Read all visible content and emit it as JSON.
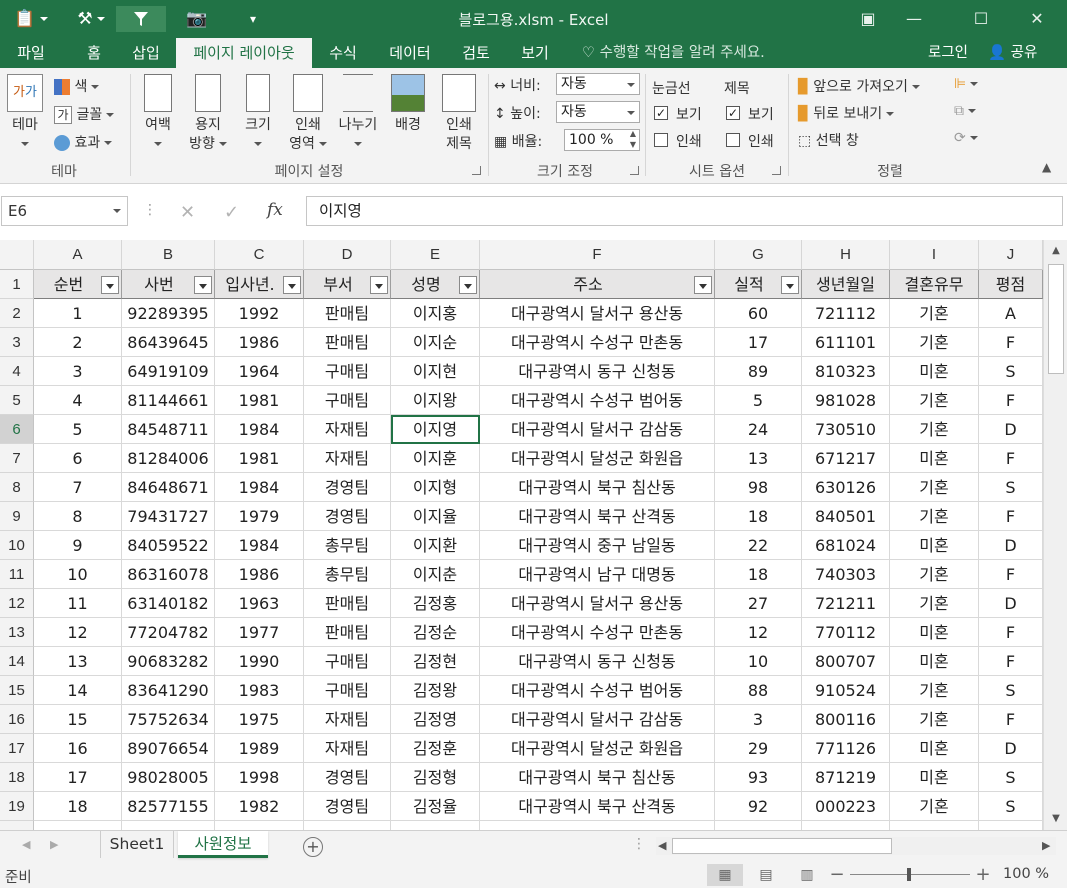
{
  "window": {
    "title": "블로그용.xlsm - Excel"
  },
  "ribbon_tabs": [
    "파일",
    "홈",
    "삽입",
    "페이지 레이아웃",
    "수식",
    "데이터",
    "검토",
    "보기"
  ],
  "tell_me": "수행할 작업을 알려 주세요.",
  "account": {
    "login": "로그인",
    "share": "공유"
  },
  "ribbon": {
    "theme": {
      "themes": "테마",
      "colors": "색",
      "fonts": "글꼴",
      "effects": "효과",
      "group": "테마"
    },
    "page_setup": {
      "margins": "여백",
      "orientation_1": "용지",
      "orientation_2": "방향",
      "size": "크기",
      "print_area_1": "인쇄",
      "print_area_2": "영역",
      "breaks": "나누기",
      "background": "배경",
      "print_titles_1": "인쇄",
      "print_titles_2": "제목",
      "group": "페이지 설정"
    },
    "scale": {
      "width_label": "너비:",
      "width_value": "자동",
      "height_label": "높이:",
      "height_value": "자동",
      "scale_label": "배율:",
      "scale_value": "100 %",
      "group": "크기 조정"
    },
    "sheet_options": {
      "gridlines": "눈금선",
      "headings": "제목",
      "view": "보기",
      "print": "인쇄",
      "group": "시트 옵션"
    },
    "arrange": {
      "bring_forward": "앞으로 가져오기",
      "send_backward": "뒤로 보내기",
      "selection_pane": "선택 창",
      "group": "정렬"
    }
  },
  "formula_bar": {
    "name_box": "E6",
    "formula": "이지영",
    "fx": "fx"
  },
  "columns": [
    "A",
    "B",
    "C",
    "D",
    "E",
    "F",
    "G",
    "H",
    "I",
    "J"
  ],
  "header_row": [
    "순번",
    "사번",
    "입사년.",
    "부서",
    "성명",
    "주소",
    "실적",
    "생년월일",
    "결혼유무",
    "평점"
  ],
  "rows": [
    [
      "1",
      "92289395",
      "1992",
      "판매팀",
      "이지홍",
      "대구광역시 달서구 용산동",
      "60",
      "721112",
      "기혼",
      "A"
    ],
    [
      "2",
      "86439645",
      "1986",
      "판매팀",
      "이지순",
      "대구광역시 수성구 만촌동",
      "17",
      "611101",
      "기혼",
      "F"
    ],
    [
      "3",
      "64919109",
      "1964",
      "구매팀",
      "이지현",
      "대구광역시 동구 신청동",
      "89",
      "810323",
      "미혼",
      "S"
    ],
    [
      "4",
      "81144661",
      "1981",
      "구매팀",
      "이지왕",
      "대구광역시 수성구 범어동",
      "5",
      "981028",
      "기혼",
      "F"
    ],
    [
      "5",
      "84548711",
      "1984",
      "자재팀",
      "이지영",
      "대구광역시 달서구 감삼동",
      "24",
      "730510",
      "기혼",
      "D"
    ],
    [
      "6",
      "81284006",
      "1981",
      "자재팀",
      "이지훈",
      "대구광역시 달성군 화원읍",
      "13",
      "671217",
      "미혼",
      "F"
    ],
    [
      "7",
      "84648671",
      "1984",
      "경영팀",
      "이지형",
      "대구광역시 북구 침산동",
      "98",
      "630126",
      "기혼",
      "S"
    ],
    [
      "8",
      "79431727",
      "1979",
      "경영팀",
      "이지율",
      "대구광역시 북구 산격동",
      "18",
      "840501",
      "기혼",
      "F"
    ],
    [
      "9",
      "84059522",
      "1984",
      "총무팀",
      "이지환",
      "대구광역시 중구 남일동",
      "22",
      "681024",
      "미혼",
      "D"
    ],
    [
      "10",
      "86316078",
      "1986",
      "총무팀",
      "이지춘",
      "대구광역시 남구 대명동",
      "18",
      "740303",
      "기혼",
      "F"
    ],
    [
      "11",
      "63140182",
      "1963",
      "판매팀",
      "김정홍",
      "대구광역시 달서구 용산동",
      "27",
      "721211",
      "기혼",
      "D"
    ],
    [
      "12",
      "77204782",
      "1977",
      "판매팀",
      "김정순",
      "대구광역시 수성구 만촌동",
      "12",
      "770112",
      "미혼",
      "F"
    ],
    [
      "13",
      "90683282",
      "1990",
      "구매팀",
      "김정현",
      "대구광역시 동구 신청동",
      "10",
      "800707",
      "미혼",
      "F"
    ],
    [
      "14",
      "83641290",
      "1983",
      "구매팀",
      "김정왕",
      "대구광역시 수성구 범어동",
      "88",
      "910524",
      "기혼",
      "S"
    ],
    [
      "15",
      "75752634",
      "1975",
      "자재팀",
      "김정영",
      "대구광역시 달서구 감삼동",
      "3",
      "800116",
      "기혼",
      "F"
    ],
    [
      "16",
      "89076654",
      "1989",
      "자재팀",
      "김정훈",
      "대구광역시 달성군 화원읍",
      "29",
      "771126",
      "미혼",
      "D"
    ],
    [
      "17",
      "98028005",
      "1998",
      "경영팀",
      "김정형",
      "대구광역시 북구 침산동",
      "93",
      "871219",
      "미혼",
      "S"
    ],
    [
      "18",
      "82577155",
      "1982",
      "경영팀",
      "김정율",
      "대구광역시 북구 산격동",
      "92",
      "000223",
      "기혼",
      "S"
    ]
  ],
  "sheets": [
    "Sheet1",
    "사원정보"
  ],
  "active_sheet": "사원정보",
  "status": {
    "ready": "준비",
    "zoom": "100 %"
  },
  "colors": {
    "brand": "#217346",
    "header_fill": "#e7e6e6"
  }
}
